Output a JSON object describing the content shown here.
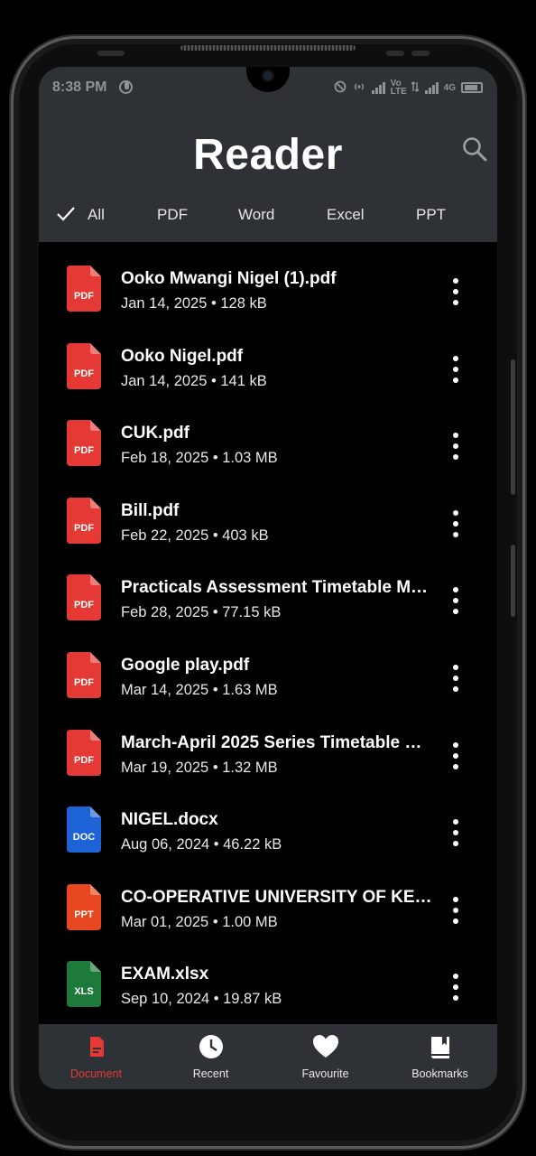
{
  "status_bar": {
    "time": "8:38 PM",
    "network": "Vo LTE",
    "net2": "4G"
  },
  "app": {
    "title": "Reader"
  },
  "filter_tabs": [
    {
      "label": "All",
      "selected": true
    },
    {
      "label": "PDF",
      "selected": false
    },
    {
      "label": "Word",
      "selected": false
    },
    {
      "label": "Excel",
      "selected": false
    },
    {
      "label": "PPT",
      "selected": false
    }
  ],
  "files": [
    {
      "name": "Ooko Mwangi Nigel (1).pdf",
      "date": "Jan 14, 2025",
      "size": "128 kB",
      "type": "PDF"
    },
    {
      "name": "Ooko Nigel.pdf",
      "date": "Jan 14, 2025",
      "size": "141 kB",
      "type": "PDF"
    },
    {
      "name": "CUK.pdf",
      "date": "Feb 18, 2025",
      "size": "1.03 MB",
      "type": "PDF"
    },
    {
      "name": "Bill.pdf",
      "date": "Feb 22, 2025",
      "size": "403 kB",
      "type": "PDF"
    },
    {
      "name": "Practicals Assessment Timetable M…",
      "date": "Feb 28, 2025",
      "size": "77.15 kB",
      "type": "PDF"
    },
    {
      "name": "Google play.pdf",
      "date": "Mar 14, 2025",
      "size": "1.63 MB",
      "type": "PDF"
    },
    {
      "name": "March-April 2025 Series Timetable …",
      "date": "Mar 19, 2025",
      "size": "1.32 MB",
      "type": "PDF"
    },
    {
      "name": "NIGEL.docx",
      "date": "Aug 06, 2024",
      "size": "46.22 kB",
      "type": "DOC"
    },
    {
      "name": "CO-OPERATIVE UNIVERSITY OF KE…",
      "date": "Mar 01, 2025",
      "size": "1.00 MB",
      "type": "PPT"
    },
    {
      "name": "EXAM.xlsx",
      "date": "Sep 10, 2024",
      "size": "19.87 kB",
      "type": "XLS"
    }
  ],
  "bottom_nav": [
    {
      "label": "Document",
      "icon": "document-icon",
      "active": true
    },
    {
      "label": "Recent",
      "icon": "clock-icon",
      "active": false
    },
    {
      "label": "Favourite",
      "icon": "heart-icon",
      "active": false
    },
    {
      "label": "Bookmarks",
      "icon": "book-icon",
      "active": false
    }
  ],
  "colors": {
    "pdf": "#e53935",
    "doc": "#1e63d6",
    "ppt": "#e8471f",
    "xls": "#1d7a3a",
    "header_bg": "#2e3237",
    "accent": "#e53935"
  }
}
